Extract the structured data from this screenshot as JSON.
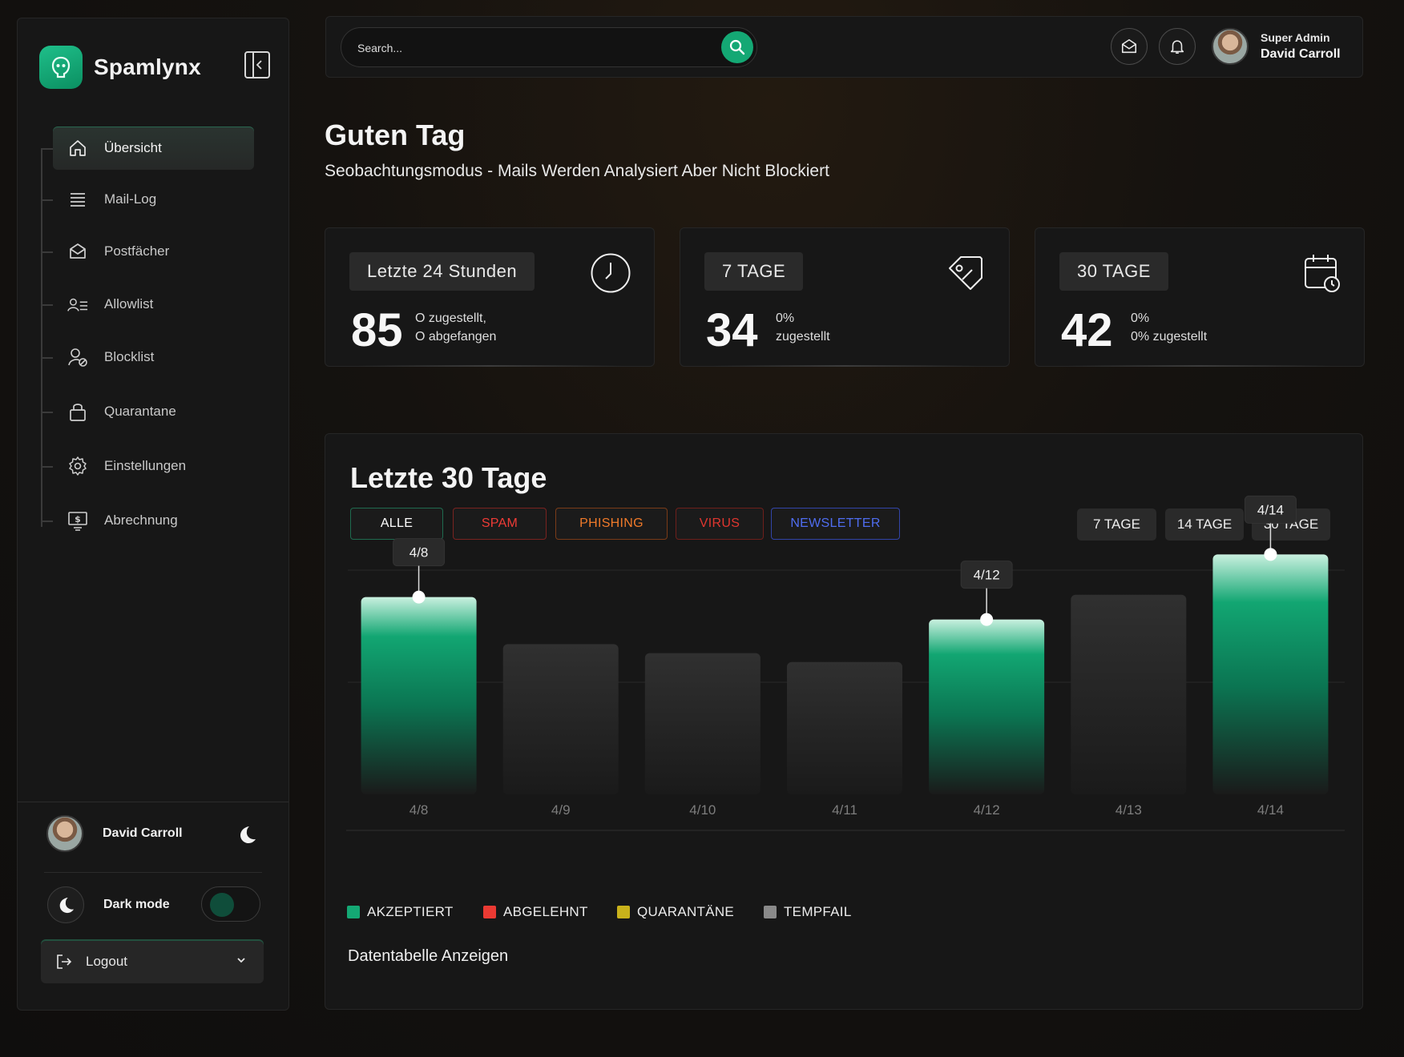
{
  "brand": {
    "name": "Spamlynx"
  },
  "sidebar": {
    "items": [
      {
        "label": "Übersicht",
        "icon": "home-icon",
        "active": true
      },
      {
        "label": "Mail-Log",
        "icon": "list-icon"
      },
      {
        "label": "Postfächer",
        "icon": "mailbox-icon"
      },
      {
        "label": "Allowlist",
        "icon": "user-list-icon"
      },
      {
        "label": "Blocklist",
        "icon": "user-block-icon"
      },
      {
        "label": "Quarantane",
        "icon": "lock-icon"
      },
      {
        "label": "Einstellungen",
        "icon": "gear-icon"
      },
      {
        "label": "Abrechnung",
        "icon": "billing-icon"
      }
    ],
    "user_name": "David Carroll",
    "dark_mode_label": "Dark mode",
    "logout_label": "Logout"
  },
  "topbar": {
    "search_placeholder": "Search...",
    "role": "Super Admin",
    "name": "David Carroll"
  },
  "greeting": {
    "title": "Guten Tag",
    "subtitle": "Seobachtungsmodus - Mails Werden Analysiert Aber Nicht Blockiert"
  },
  "stats": [
    {
      "label": "Letzte 24  Stunden",
      "value": "85",
      "line1": "O zugestellt,",
      "line2": "O abgefangen",
      "icon": "clock-icon"
    },
    {
      "label": "7 TAGE",
      "value": "34",
      "line1": "0%",
      "line2": "zugestellt",
      "icon": "tag-icon"
    },
    {
      "label": "30 TAGE",
      "value": "42",
      "line1": "0%",
      "line2": "0% zugestellt",
      "icon": "calendar-clock-icon"
    }
  ],
  "chart_panel": {
    "title": "Letzte 30 Tage",
    "filters": [
      {
        "label": "ALLE",
        "color": "#ffffff",
        "border": "#1f6b4f"
      },
      {
        "label": "SPAM",
        "color": "#ef3b36",
        "border": "#7a2320"
      },
      {
        "label": "PHISHING",
        "color": "#f07a2a",
        "border": "#7a3b18"
      },
      {
        "label": "VIRUS",
        "color": "#e0362f",
        "border": "#6e1f1b"
      },
      {
        "label": "NEWSLETTER",
        "color": "#4f6df0",
        "border": "#3245a8"
      }
    ],
    "ranges": [
      "7 TAGE",
      "14 TAGE",
      "30 TAGE"
    ],
    "legend": [
      {
        "label": "AKZEPTIERT",
        "color": "#14a874"
      },
      {
        "label": "ABGELEHNT",
        "color": "#ea3a33"
      },
      {
        "label": "QUARANTÄNE",
        "color": "#c9b21b"
      },
      {
        "label": "TEMPFAIL",
        "color": "#8a8a8a"
      }
    ],
    "data_table_link": "Datentabelle Anzeigen"
  },
  "chart_data": {
    "type": "bar",
    "categories": [
      "4/8",
      "4/9",
      "4/10",
      "4/11",
      "4/12",
      "4/13",
      "4/14"
    ],
    "values": [
      88,
      67,
      63,
      59,
      78,
      89,
      107
    ],
    "highlighted": [
      true,
      false,
      false,
      false,
      true,
      false,
      true
    ],
    "tooltips": [
      "4/8",
      "",
      "",
      "",
      "4/12",
      "",
      "4/14"
    ],
    "ylim": [
      0,
      110
    ],
    "grid": true,
    "colors": {
      "highlight": "#0fa26d",
      "normal": "#2c2c2c"
    }
  }
}
